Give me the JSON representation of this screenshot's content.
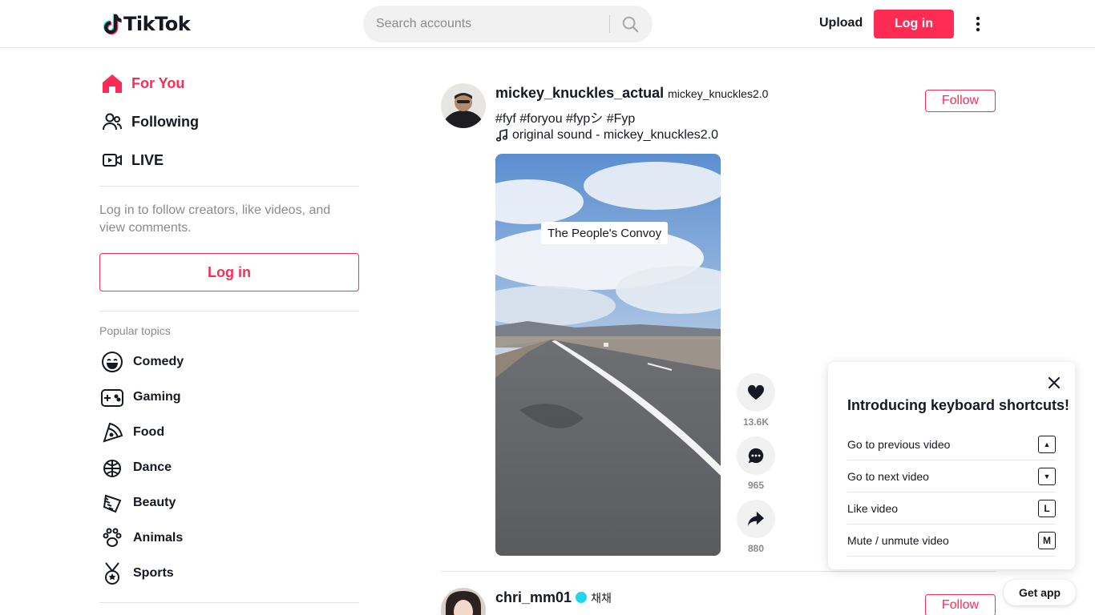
{
  "header": {
    "logo_text": "TikTok",
    "search_placeholder": "Search accounts",
    "upload_label": "Upload",
    "login_label": "Log in"
  },
  "sidebar": {
    "nav": [
      {
        "label": "For You",
        "icon": "home-icon",
        "active": true
      },
      {
        "label": "Following",
        "icon": "people-icon",
        "active": false
      },
      {
        "label": "LIVE",
        "icon": "live-icon",
        "active": false
      }
    ],
    "login_hint": "Log in to follow creators, like videos, and view comments.",
    "login_label": "Log in",
    "topics_title": "Popular topics",
    "topics": [
      {
        "label": "Comedy",
        "icon": "comedy-icon"
      },
      {
        "label": "Gaming",
        "icon": "gaming-icon"
      },
      {
        "label": "Food",
        "icon": "food-icon"
      },
      {
        "label": "Dance",
        "icon": "dance-icon"
      },
      {
        "label": "Beauty",
        "icon": "beauty-icon"
      },
      {
        "label": "Animals",
        "icon": "animals-icon"
      },
      {
        "label": "Sports",
        "icon": "sports-icon"
      }
    ]
  },
  "feed": {
    "posts": [
      {
        "username": "mickey_knuckles_actual",
        "nickname": "mickey_knuckles2.0",
        "caption": "#fyf #foryou #fypシ #Fyp",
        "sound": "original sound - mickey_knuckles2.0",
        "follow_label": "Follow",
        "video_overlay_text": "The People's Convoy",
        "likes": "13.6K",
        "comments": "965",
        "shares": "880"
      },
      {
        "username": "chri_mm01",
        "nickname": "채채",
        "nickname_prefix": "",
        "follow_label": "Follow",
        "verified": true
      }
    ]
  },
  "shortcuts": {
    "title": "Introducing keyboard shortcuts!",
    "items": [
      {
        "label": "Go to previous video",
        "key": "▲"
      },
      {
        "label": "Go to next video",
        "key": "▼"
      },
      {
        "label": "Like video",
        "key": "L"
      },
      {
        "label": "Mute / unmute video",
        "key": "M"
      }
    ]
  },
  "get_app_label": "Get app",
  "colors": {
    "brand": "#fe2c55",
    "text": "#161823",
    "muted": "#8a8b91",
    "verified": "#20d5ec"
  }
}
